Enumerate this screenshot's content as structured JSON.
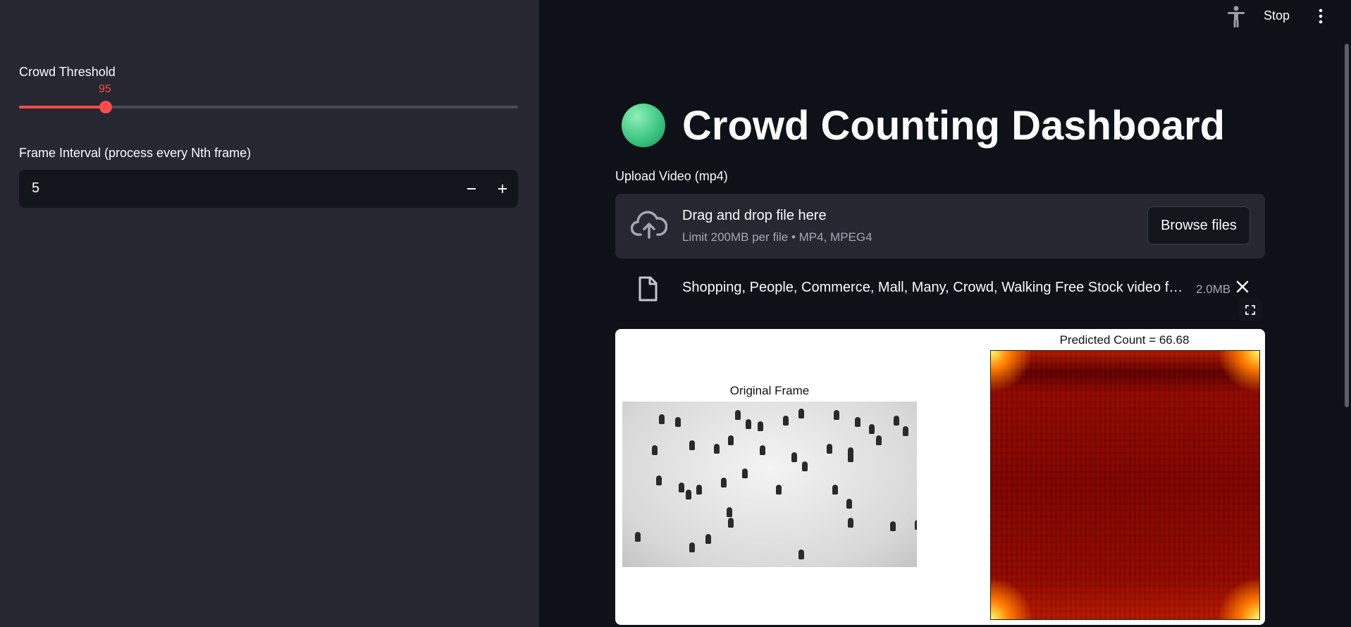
{
  "sidebar": {
    "slider": {
      "label": "Crowd Threshold",
      "value": "95",
      "fraction": 0.174
    },
    "number_input": {
      "label": "Frame Interval (process every Nth frame)",
      "value": "5"
    }
  },
  "toolbar": {
    "stop_label": "Stop"
  },
  "main": {
    "title": "Crowd Counting Dashboard",
    "uploader": {
      "label": "Upload Video (mp4)",
      "drop_text": "Drag and drop file here",
      "limit_text": "Limit 200MB per file • MP4, MPEG4",
      "browse_label": "Browse files"
    },
    "file": {
      "name": "Shopping, People, Commerce, Mall, Many, Crowd, Walking Free Stock video f…",
      "size": "2.0MB"
    },
    "figure": {
      "left_title": "Original Frame",
      "right_title": "Predicted Count = 66.68"
    }
  },
  "colors": {
    "accent": "#ff4b4b",
    "sidebar_bg": "#262730",
    "main_bg": "#0e1117",
    "orb": "#38c37d"
  },
  "icons": [
    "accessibility-icon",
    "more-vert-icon",
    "cloud-upload-icon",
    "file-icon",
    "close-icon",
    "fullscreen-icon",
    "minus-icon",
    "plus-icon"
  ]
}
